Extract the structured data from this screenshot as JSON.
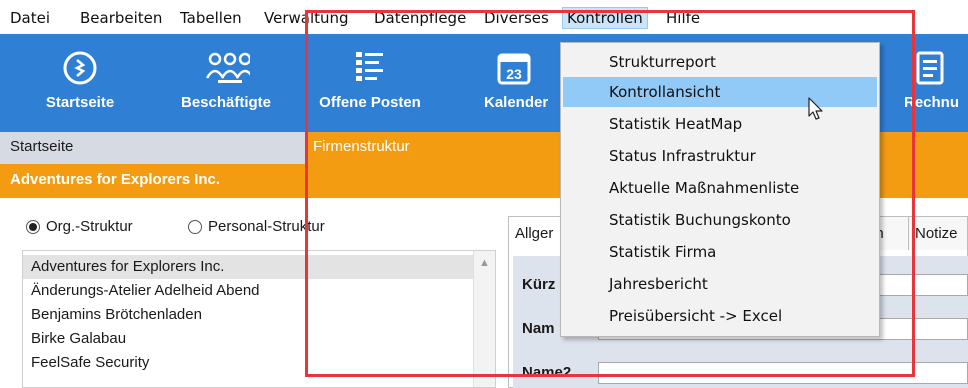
{
  "menubar": {
    "items": [
      "Datei",
      "Bearbeiten",
      "Tabellen",
      "Verwaltung",
      "Datenpflege",
      "Diverses",
      "Kontrollen",
      "Hilfe"
    ],
    "active": "Kontrollen"
  },
  "toolbar": {
    "buttons": [
      {
        "label": "Startseite",
        "icon": "home-circle-icon"
      },
      {
        "label": "Beschäftigte",
        "icon": "people-icon"
      },
      {
        "label": "Offene Posten",
        "icon": "list-icon"
      },
      {
        "label": "Kalender",
        "icon": "calendar-icon"
      },
      {
        "label": "Rechnu",
        "icon": "document-icon"
      }
    ],
    "calendar_day": "23"
  },
  "breadcrumb": {
    "left": "Startseite",
    "right": "Firmenstruktur"
  },
  "banner": {
    "company": "Adventures for Explorers Inc."
  },
  "structure": {
    "org_label": "Org.-Struktur",
    "personal_label": "Personal-Struktur",
    "selected": "org"
  },
  "company_list": [
    "Adventures for Explorers Inc.",
    "Änderungs-Atelier Adelheid Abend",
    "Benjamins Brötchenladen",
    "Birke Galabau",
    "FeelSafe Security"
  ],
  "tabs": {
    "first": "Allger",
    "partial": "en",
    "last": "Notize"
  },
  "form": {
    "kurz_label": "Kürz",
    "name_label": "Nam",
    "name2_label": "Name2"
  },
  "dropdown": {
    "items": [
      "Strukturreport",
      "Kontrollansicht",
      "Statistik HeatMap",
      "Status Infrastruktur",
      "Aktuelle Maßnahmenliste",
      "Statistik Buchungskonto",
      "Statistik Firma",
      "Jahresbericht",
      "Preisübersicht -> Excel"
    ],
    "hovered": "Kontrollansicht"
  },
  "colors": {
    "toolbar_blue": "#2f7fd4",
    "accent_orange": "#f39c12",
    "highlight_red": "#e8353b",
    "menu_hover": "#91c9f7"
  }
}
